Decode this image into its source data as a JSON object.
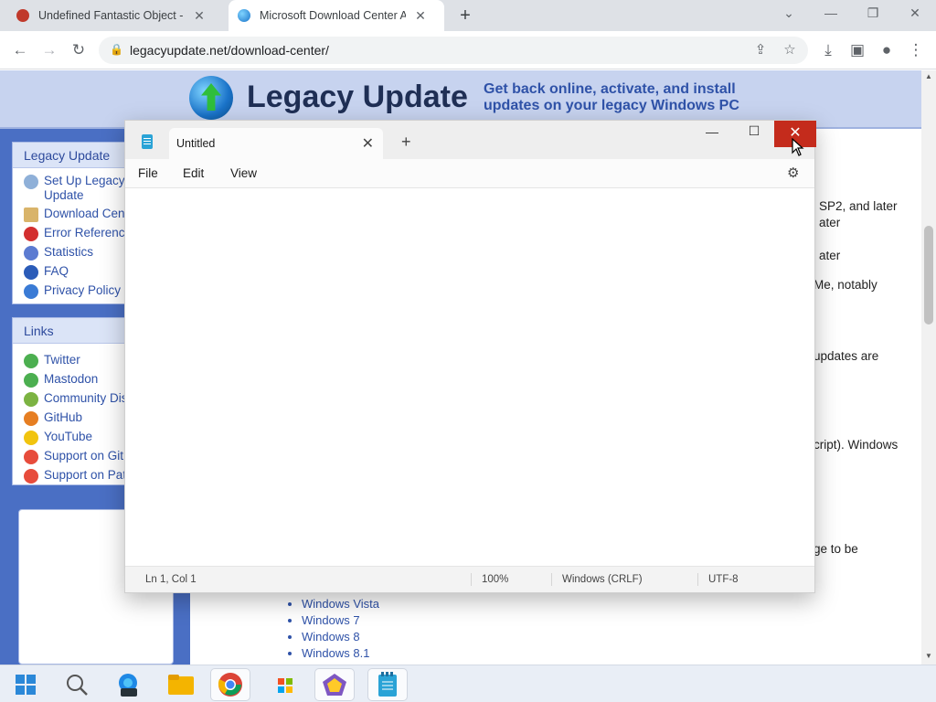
{
  "browser": {
    "tabs": [
      {
        "title": "Undefined Fantastic Object - Touhou",
        "active": false
      },
      {
        "title": "Microsoft Download Center Archive",
        "active": true
      }
    ],
    "url": "legacyupdate.net/download-center/"
  },
  "site": {
    "brand": "Legacy Update",
    "tagline_line1": "Get back online, activate, and install",
    "tagline_line2": "updates on your legacy Windows PC",
    "sidebar": {
      "box1_title": "Legacy Update",
      "box1_items": [
        "Set Up Legacy",
        "Update",
        "Download Center",
        "Error Reference",
        "Statistics",
        "FAQ",
        "Privacy Policy"
      ],
      "box2_title": "Links",
      "box2_items": [
        "Twitter",
        "Mastodon",
        "Community Discord",
        "GitHub",
        "YouTube",
        "Support on GitHub",
        "Support on Patreon"
      ]
    },
    "content_fragments": [
      "SP2, and later",
      "ater",
      "ater",
      "Me, notably",
      "updates are",
      "cript). Windows",
      "ge to be"
    ],
    "os_list": [
      "Windows Vista",
      "Windows 7",
      "Windows 8",
      "Windows 8.1"
    ]
  },
  "notepad": {
    "tab_title": "Untitled",
    "menu": {
      "file": "File",
      "edit": "Edit",
      "view": "View"
    },
    "content": "",
    "status": {
      "position": "Ln 1, Col 1",
      "zoom": "100%",
      "line_ending": "Windows (CRLF)",
      "encoding": "UTF-8"
    }
  },
  "taskbar": {
    "items": [
      "start-icon",
      "search-icon",
      "edge-beta-icon",
      "file-explorer-icon",
      "chrome-icon",
      "microsoft-store-icon",
      "pentagon-app-icon",
      "notepad-icon"
    ]
  },
  "colors": {
    "accent_close": "#c42b1c",
    "site_blue": "#4a6fc4",
    "link_blue": "#2f52a8"
  }
}
